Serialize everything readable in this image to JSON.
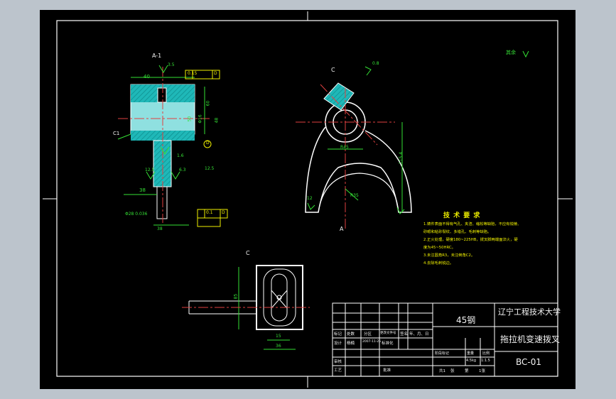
{
  "dimension_labels": {
    "section_label": "A-1",
    "top_dim_40": "40",
    "finish_35": "3.5",
    "fcf_top": [
      "0.15",
      "D"
    ],
    "dim_60": "60",
    "dim_e16": "Φ16",
    "chamfer_c1": "C1",
    "dim_48": "48",
    "dim_50": "50",
    "finish_16": "1.6",
    "datum_d": "D",
    "rough_25_left": "12.5",
    "rough_63_left": "6.3",
    "rough_25_right": "12.5",
    "dim_38": "38",
    "dim_shaft": "Φ28 0.036",
    "fcf_bottom": [
      "0.1",
      "D"
    ],
    "dim_bottom": "38",
    "view_c_top": "C",
    "finish_08": "0.8",
    "dim_r45": "R45",
    "dim_115": "115.4",
    "dim_r35": "R35",
    "dim_12": "12",
    "view_a": "A",
    "finish_note": "其余",
    "view_c_bottom": "C",
    "dim_85": "85",
    "dim_15": "15",
    "dim_36": "36"
  },
  "tech_requirements": {
    "title": "技 术 要 求",
    "items": [
      "1.铸件表面不得有气孔、夹渣、缩松等缺陷，不应有锐棱、",
      "  砂眼和粘砂裂纹、多错孔、毛刺等缺陷。",
      "2.正火处理，硬度180~225HB，拨叉脚两端面淬火，硬",
      "  度为45~50HRC。",
      "3.未注圆角R3，未注倒角C2。",
      "4.去除毛刺锐边。"
    ]
  },
  "title_block": {
    "material": "45钢",
    "school": "辽宁工程技术大学",
    "part_name": "拖拉机变速拨叉",
    "drawing_no": "BC-01",
    "rev_headers": [
      "标记",
      "处数",
      "分区",
      "更改文件号",
      "签名",
      "年、月、日"
    ],
    "design_row": [
      "设计",
      "杨楠",
      "2007-11-25",
      "标准化"
    ],
    "review_label": "审核",
    "process_label": "工艺",
    "approve_label": "批准",
    "stage_header": [
      "阶段标记",
      "重量",
      "比例"
    ],
    "weight": "4.5kg",
    "scale": "1:1.5",
    "sheet_info": [
      "共1",
      "张",
      "第",
      "1张"
    ]
  }
}
